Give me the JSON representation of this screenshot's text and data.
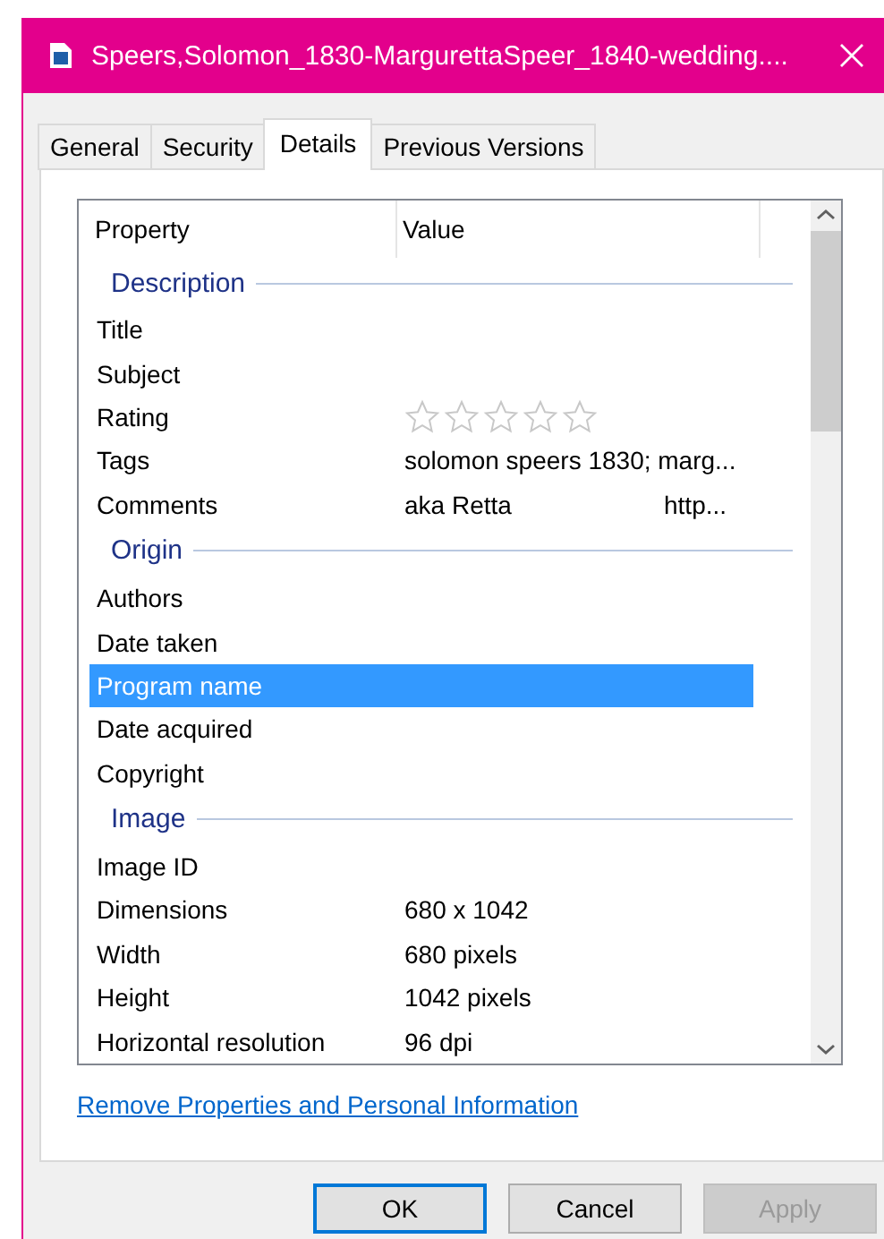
{
  "window": {
    "title": "Speers,Solomon_1830-MargurettaSpeer_1840-wedding...."
  },
  "tabs": [
    {
      "label": "General",
      "selected": false
    },
    {
      "label": "Security",
      "selected": false
    },
    {
      "label": "Details",
      "selected": true
    },
    {
      "label": "Previous Versions",
      "selected": false
    }
  ],
  "table": {
    "columns": [
      "Property",
      "Value"
    ],
    "groups": [
      {
        "title": "Description",
        "rows": [
          {
            "kind": "text",
            "property": "Title",
            "selected": false
          },
          {
            "kind": "text",
            "property": "Subject",
            "selected": false
          },
          {
            "kind": "stars",
            "property": "Rating",
            "stars": 0,
            "selected": false
          },
          {
            "kind": "text",
            "property": "Tags",
            "value": "solomon speers 1830; marg...",
            "selected": false
          },
          {
            "kind": "split",
            "property": "Comments",
            "value": "aka Retta",
            "value_2": "http...",
            "selected": false
          }
        ]
      },
      {
        "title": "Origin",
        "rows": [
          {
            "kind": "text",
            "property": "Authors",
            "selected": false
          },
          {
            "kind": "text",
            "property": "Date taken",
            "selected": false
          },
          {
            "kind": "text",
            "property": "Program name",
            "selected": true
          },
          {
            "kind": "text",
            "property": "Date acquired",
            "selected": false
          },
          {
            "kind": "text",
            "property": "Copyright",
            "selected": false
          }
        ]
      },
      {
        "title": "Image",
        "rows": [
          {
            "kind": "text",
            "property": "Image ID",
            "selected": false
          },
          {
            "kind": "text",
            "property": "Dimensions",
            "value": "680 x 1042",
            "selected": false
          },
          {
            "kind": "text",
            "property": "Width",
            "value": "680 pixels",
            "selected": false
          },
          {
            "kind": "text",
            "property": "Height",
            "value": "1042 pixels",
            "selected": false
          },
          {
            "kind": "text",
            "property": "Horizontal resolution",
            "value": "96 dpi",
            "selected": false
          }
        ]
      }
    ]
  },
  "link": "Remove Properties and Personal Information",
  "buttons": [
    {
      "label": "OK",
      "default": true,
      "disabled": false
    },
    {
      "label": "Cancel",
      "default": false,
      "disabled": false
    },
    {
      "label": "Apply",
      "default": false,
      "disabled": true
    }
  ]
}
